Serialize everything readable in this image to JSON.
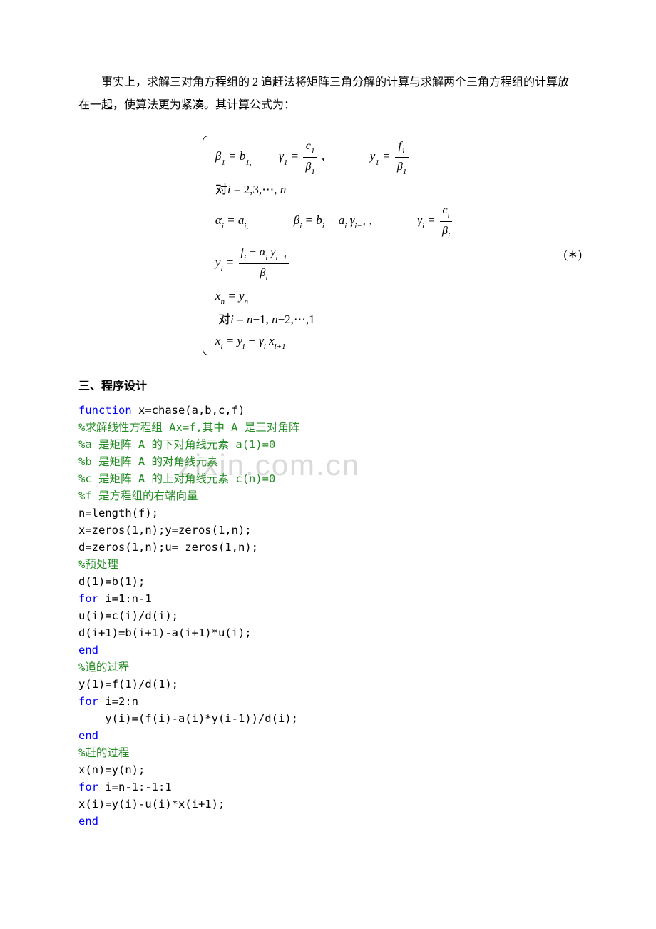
{
  "paragraph1": "事实上，求解三对角方程组的 2 追赶法将矩阵三角分解的计算与求解两个三角方程组的计算放在一起，使算法更为紧凑。其计算公式为：",
  "formula": {
    "line1a": "β",
    "line1b": " = b",
    "line1c": "γ",
    "line1d": " = ",
    "line1_frac_num": "c",
    "line1_frac_den": "β",
    "line1e": "y",
    "line1f": " = ",
    "line1_frac2_num": "f",
    "line1_frac2_den": "β",
    "line2": "对i = 2,3,⋯,n",
    "line3a": "α",
    "line3b": " = a",
    "line3c": "β",
    "line3d": " = b",
    "line3e": " − a",
    "line3f": "γ",
    "line3g": "γ",
    "line3h": " = ",
    "line3_frac_num": "c",
    "line3_frac_den": "β",
    "line4a": "y",
    "line4b": " = ",
    "line4_frac_num_a": "f",
    "line4_frac_num_b": " − α",
    "line4_frac_num_c": " y",
    "line4_frac_den": "β",
    "line5a": "x",
    "line5b": " = y",
    "line6": "对i = n−1, n−2,⋯,1",
    "line7a": "x",
    "line7b": " = y",
    "line7c": " − γ",
    "line7d": " x",
    "star": "(∗)",
    "sub1": "1",
    "sub1comma": "1,",
    "subi": "i",
    "subicomma": "i,",
    "subim1": "i−1",
    "subip1": "i+1",
    "subn": "n"
  },
  "heading": "三、程序设计",
  "code": {
    "l1_kw": "function",
    "l1_rest": " x=chase(a,b,c,f)",
    "l2": "%求解线性方程组 Ax=f,其中 A 是三对角阵",
    "l3": "%a 是矩阵 A 的下对角线元素 a(1)=0",
    "l4": "%b 是矩阵 A 的对角线元素",
    "l5": "%c 是矩阵 A 的上对角线元素 c(n)=0",
    "l6": "%f 是方程组的右端向量",
    "l7": "n=length(f);",
    "l8": "x=zeros(1,n);y=zeros(1,n);",
    "l9": "d=zeros(1,n);u= zeros(1,n);",
    "l10": "%预处理",
    "l11": "d(1)=b(1);",
    "l12_kw": "for",
    "l12_rest": " i=1:n-1",
    "l13": "u(i)=c(i)/d(i);",
    "l14": "d(i+1)=b(i+1)-a(i+1)*u(i);",
    "l15_kw": "end",
    "l16": "%追的过程",
    "l17": "y(1)=f(1)/d(1);",
    "l18_kw": "for",
    "l18_rest": " i=2:n",
    "l19": "    y(i)=(f(i)-a(i)*y(i-1))/d(i);",
    "l20_kw": "end",
    "l21": "%赶的过程",
    "l22": "x(n)=y(n);",
    "l23_kw": "for",
    "l23_rest": " i=n-1:-1:1",
    "l24": "x(i)=y(i)-u(i)*x(i+1);",
    "l25_kw": "end"
  },
  "watermark": "zixin.com.cn"
}
